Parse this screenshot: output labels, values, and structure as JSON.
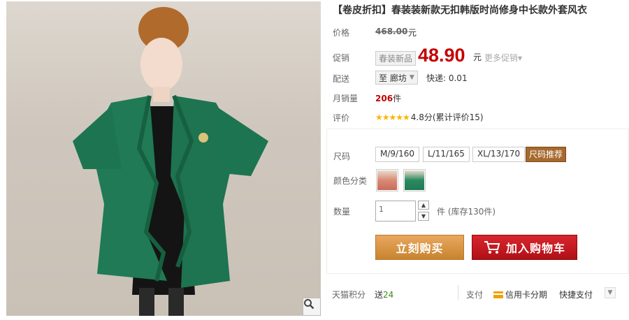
{
  "product": {
    "title": "【卷皮折扣】春装装新款无扣韩版时尚修身中长款外套风衣",
    "image_alt": "green coat product photo"
  },
  "price": {
    "label": "价格",
    "original": "468.00",
    "unit": "元"
  },
  "promo": {
    "label": "促销",
    "tag": "春装新品",
    "price": "48.90",
    "unit": "元",
    "more": "更多促销▾"
  },
  "shipping": {
    "label": "配送",
    "destination": "至 廊坊",
    "fee": "快递: 0.01"
  },
  "monthly_sales": {
    "label": "月销量",
    "count": "206",
    "unit": "件"
  },
  "review": {
    "label": "评价",
    "stars": "★★★★★",
    "score": "4.8分(累计评价15)"
  },
  "options": {
    "size_label": "尺码",
    "sizes": [
      "M/9/160",
      "L/11/165",
      "XL/13/170"
    ],
    "size_recommend": "尺码推荐",
    "color_label": "颜色分类",
    "qty_label": "数量",
    "qty_value": "1",
    "stock": "件 (库存130件)"
  },
  "actions": {
    "buy_now": "立刻购买",
    "add_to_cart": "加入购物车"
  },
  "footer": {
    "points_label": "天猫积分",
    "points_value": "送",
    "points_number": "24",
    "pay_label": "支付",
    "installment": "信用卡分期",
    "quick_pay": "快捷支付"
  },
  "colors": {
    "accent_red": "#c40000",
    "buy_orange": "#d28f40",
    "cart_red": "#c41a22",
    "coat_green": "#1f7a55"
  }
}
